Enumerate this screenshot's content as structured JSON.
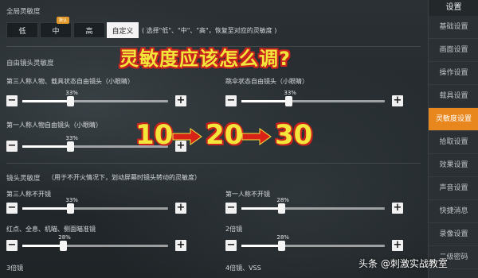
{
  "headline": "灵敏度应该怎么调?",
  "progression": {
    "n1": "10",
    "n2": "20",
    "n3": "30"
  },
  "global": {
    "title": "全局灵敏度",
    "badge": "默认",
    "presets": [
      "低",
      "中",
      "高",
      "自定义"
    ],
    "active": "自定义",
    "hint": "( 选择\"低\"、\"中\"、\"高\"，恢复至对应的灵敏度 )"
  },
  "free_look": {
    "title": "自由镜头灵敏度",
    "sliders": [
      {
        "label": "第三人称人物、载具状态自由镜头（小眼睛）",
        "value": "33%",
        "level": 0.33
      },
      {
        "label": "跳伞状态自由镜头（小眼睛）",
        "value": "33%",
        "level": 0.33
      },
      {
        "label": "第一人称人物自由镜头（小眼睛）",
        "value": "33%",
        "level": 0.33
      }
    ]
  },
  "camera": {
    "title": "镜头灵敏度",
    "hint": "（用于不开火情况下，划动屏幕时镜头转动的灵敏度）",
    "sliders": [
      {
        "label": "第三人称不开镜",
        "value": "33%",
        "level": 0.33
      },
      {
        "label": "第一人称不开镜",
        "value": "28%",
        "level": 0.28
      },
      {
        "label": "红点、全息、机瞄、侧面瞄准镜",
        "value": "28%",
        "level": 0.28
      },
      {
        "label": "2倍镜",
        "value": "28%",
        "level": 0.28
      }
    ],
    "more": [
      "3倍镜",
      "4倍镜、VSS"
    ]
  },
  "sidebar": {
    "title": "设置",
    "items": [
      "基础设置",
      "画面设置",
      "操作设置",
      "载具设置",
      "灵敏度设置",
      "拾取设置",
      "效果设置",
      "声音设置",
      "快捷消息",
      "录像设置",
      "二级密码"
    ],
    "active": "灵敏度设置"
  },
  "watermark": "头条 @刺激实战教室",
  "colors": {
    "accent": "#e8871e",
    "headline": "#f3e53a",
    "outline": "#c8231e"
  }
}
